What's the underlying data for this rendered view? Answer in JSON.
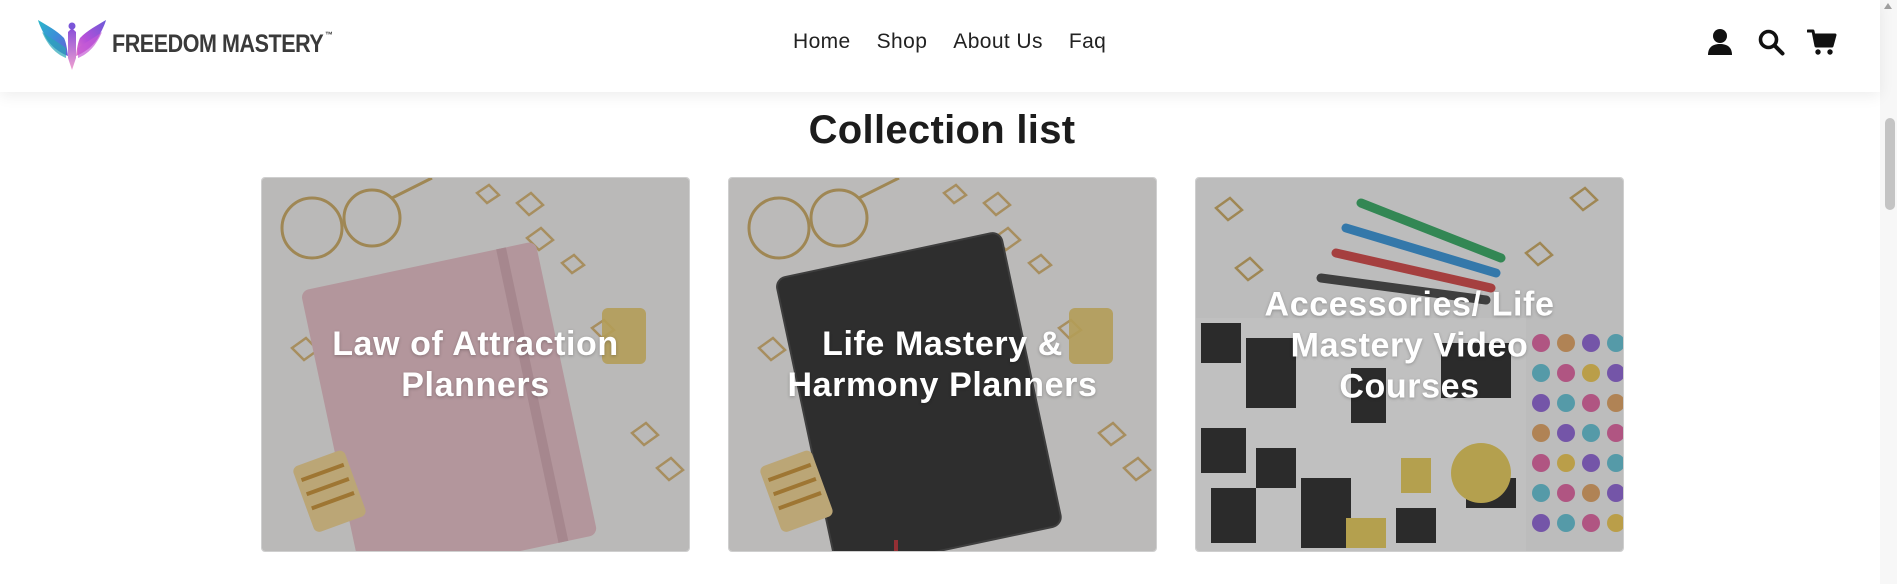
{
  "brand": {
    "name": "FREEDOM MASTERY",
    "trademark": "™",
    "logo_icon": "winged-emblem-icon",
    "colors": [
      "#2bb8c9",
      "#6a5bd8",
      "#b54fd9",
      "#e276c9"
    ]
  },
  "nav": {
    "items": [
      {
        "label": "Home"
      },
      {
        "label": "Shop"
      },
      {
        "label": "About Us"
      },
      {
        "label": "Faq"
      }
    ]
  },
  "header_icons": [
    "user-icon",
    "search-icon",
    "cart-icon"
  ],
  "collection": {
    "title": "Collection list",
    "cards": [
      {
        "title": "Law of Attraction Planners",
        "image": "pink-notebook-with-glasses-and-clips"
      },
      {
        "title": "Life Mastery & Harmony Planners",
        "image": "black-notebook-with-glasses-and-clips"
      },
      {
        "title": "Accessories/ Life Mastery Video Courses",
        "image": "pens-and-sticker-sheets"
      }
    ]
  }
}
